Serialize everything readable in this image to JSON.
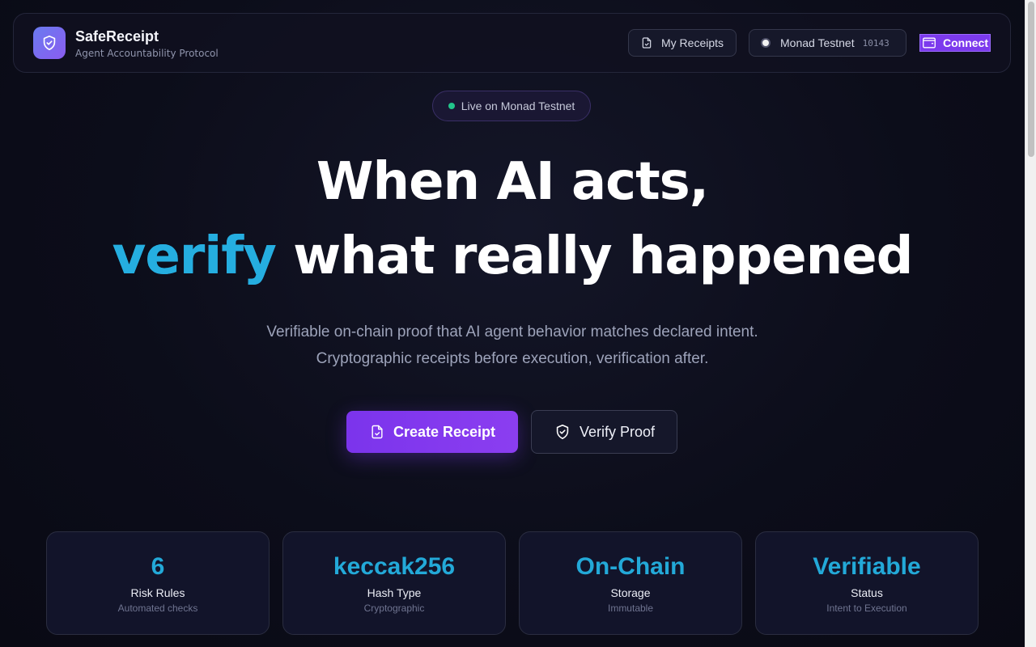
{
  "header": {
    "title": "SafeReceipt",
    "subtitle": "Agent Accountability Protocol",
    "my_receipts_label": "My Receipts",
    "network_label": "Monad Testnet",
    "chain_id": "10143",
    "connect_label": "Connect"
  },
  "badge": {
    "label": "Live on Monad Testnet"
  },
  "hero": {
    "line1": "When AI acts,",
    "line2_accent": "verify",
    "line2_rest": " what really happened",
    "description": "Verifiable on-chain proof that AI agent behavior matches declared intent. Cryptographic receipts before execution, verification after."
  },
  "cta": {
    "primary_label": "Create Receipt",
    "secondary_label": "Verify Proof"
  },
  "stats": [
    {
      "value": "6",
      "label": "Risk Rules",
      "sub": "Automated checks"
    },
    {
      "value": "keccak256",
      "label": "Hash Type",
      "sub": "Cryptographic"
    },
    {
      "value": "On-Chain",
      "label": "Storage",
      "sub": "Immutable"
    },
    {
      "value": "Verifiable",
      "label": "Status",
      "sub": "Intent to Execution"
    }
  ],
  "icons": {
    "logo": "shield-check-icon",
    "receipts": "file-check-icon",
    "network": "network-dot-icon",
    "connect": "wallet-icon",
    "create": "file-check-icon",
    "verify": "shield-check-icon"
  },
  "colors": {
    "accent": "#7c3aed",
    "highlight": "#23a9d8",
    "live": "#22c58b",
    "background": "#0c0d1a"
  }
}
